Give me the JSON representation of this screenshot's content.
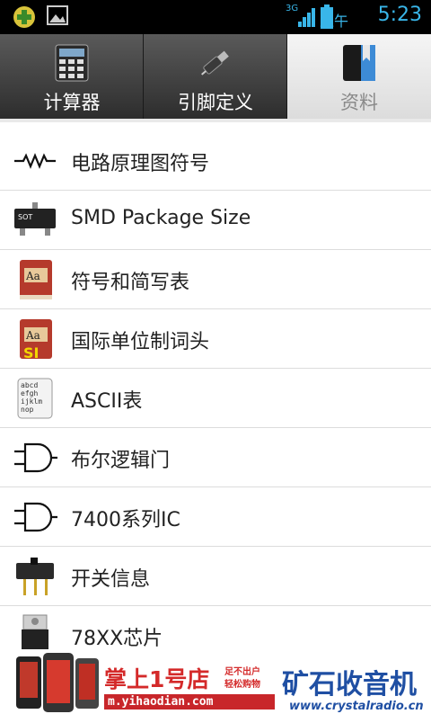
{
  "status": {
    "ampm": "上午",
    "time": "5:23",
    "network": "3G"
  },
  "tabs": [
    {
      "label": "计算器",
      "icon": "calculator-icon",
      "active": false
    },
    {
      "label": "引脚定义",
      "icon": "usb-plug-icon",
      "active": false
    },
    {
      "label": "资料",
      "icon": "book-icon",
      "active": true
    }
  ],
  "list": [
    {
      "label": "电路原理图符号",
      "icon": "resistor-icon"
    },
    {
      "label": "SMD Package Size",
      "icon": "sot-chip-icon"
    },
    {
      "label": "符号和简写表",
      "icon": "dictionary-icon"
    },
    {
      "label": "国际单位制词头",
      "icon": "si-dictionary-icon"
    },
    {
      "label": "ASCII表",
      "icon": "ascii-doc-icon"
    },
    {
      "label": "布尔逻辑门",
      "icon": "and-gate-icon"
    },
    {
      "label": "7400系列IC",
      "icon": "and-gate-icon"
    },
    {
      "label": "开关信息",
      "icon": "slide-switch-icon"
    },
    {
      "label": "78XX芯片",
      "icon": "regulator-chip-icon"
    }
  ],
  "ad": {
    "brand": "掌上1号店",
    "slogan1": "足不出户",
    "slogan2": "轻松购物",
    "url": "m.yihaodian.com",
    "site_title": "矿石收音机",
    "site_url": "www.crystalradio.cn"
  }
}
